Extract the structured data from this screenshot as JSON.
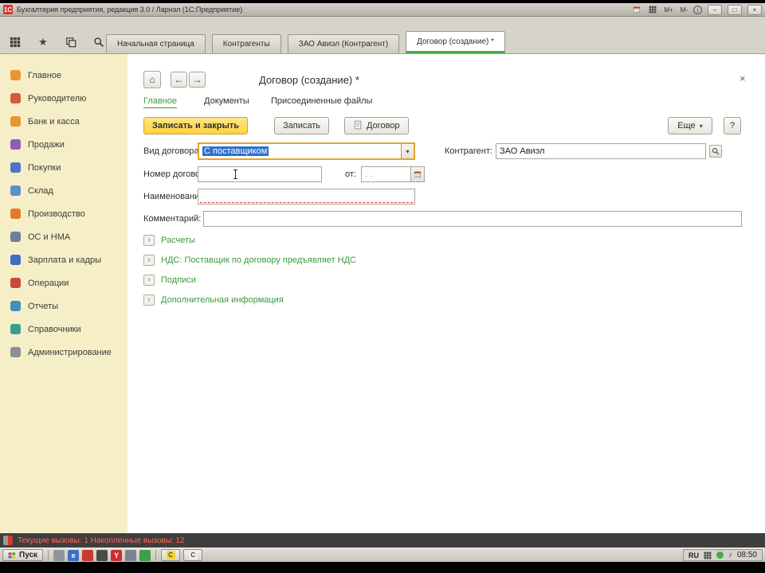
{
  "colors": {
    "accent_green": "#3c9a3c",
    "sidebar_bg": "#f6eec6",
    "save_button_yellow": "#ffd23a",
    "focus_border": "#e0a430",
    "selection_blue": "#2f6fd0",
    "required_red": "#e0392e",
    "status_text_red": "#ff6a5e"
  },
  "icons": {
    "star": "★",
    "history": "↺",
    "home": "⌂",
    "back": "←",
    "forward": "→",
    "dropdown": "▾",
    "section_arrow": "›",
    "note": "♪",
    "info": "i"
  },
  "titlebar": {
    "logo": "1С",
    "title": "Бухгалтерия предприятия, редакция 3.0 / Ларнэл (1С:Предприятие)",
    "mem_plus": "M+",
    "mem_minus": "M-",
    "minimize": "–",
    "maximize": "□",
    "close": "×"
  },
  "tabstrip": {
    "tabs": [
      {
        "label": "Начальная страница"
      },
      {
        "label": "Контрагенты"
      },
      {
        "label": "ЗАО Авиэл (Контрагент)"
      },
      {
        "label": "Договор (создание) *"
      }
    ]
  },
  "sidebar": {
    "items": [
      {
        "label": "Главное",
        "color": "#e8972e"
      },
      {
        "label": "Руководителю",
        "color": "#d8583a"
      },
      {
        "label": "Банк и касса",
        "color": "#e8972e"
      },
      {
        "label": "Продажи",
        "color": "#8e5bb8"
      },
      {
        "label": "Покупки",
        "color": "#4a77c4"
      },
      {
        "label": "Склад",
        "color": "#5b8fd4"
      },
      {
        "label": "Производство",
        "color": "#e07b28"
      },
      {
        "label": "ОС и НМА",
        "color": "#6b7f9e"
      },
      {
        "label": "Зарплата и кадры",
        "color": "#3f6fbf"
      },
      {
        "label": "Операции",
        "color": "#c44a3a"
      },
      {
        "label": "Отчеты",
        "color": "#3f8fbf"
      },
      {
        "label": "Справочники",
        "color": "#3a9e8e"
      },
      {
        "label": "Администрирование",
        "color": "#8a8f98"
      }
    ]
  },
  "form": {
    "title": "Договор (создание) *",
    "close": "×",
    "tabs": [
      {
        "label": "Главное"
      },
      {
        "label": "Документы"
      },
      {
        "label": "Присоединенные файлы"
      }
    ],
    "toolbar": {
      "save_close": "Записать и закрыть",
      "save": "Записать",
      "contract": "Договор",
      "more": "Еще",
      "help": "?"
    },
    "fields": {
      "kind": {
        "label": "Вид договора:",
        "value": "С поставщиком"
      },
      "counterparty": {
        "label": "Контрагент:",
        "value": "ЗАО Авиэл"
      },
      "number": {
        "label": "Номер договора:",
        "value": ""
      },
      "date": {
        "label": "от:",
        "placeholder": ". ."
      },
      "name": {
        "label": "Наименование:",
        "value": ""
      },
      "comment": {
        "label": "Комментарий:",
        "value": ""
      }
    },
    "sections": [
      {
        "label": "Расчеты"
      },
      {
        "label": "НДС: Поставщик по договору предъявляет НДС"
      },
      {
        "label": "Подписи"
      },
      {
        "label": "Дополнительная информация"
      }
    ]
  },
  "statusbar": {
    "text": "Текущие вызовы: 1  Накопленные вызовы: 12"
  },
  "taskbar": {
    "start": "Пуск",
    "quicklaunch": [
      {
        "letter": "",
        "bg": "#8f959e"
      },
      {
        "letter": "e",
        "bg": "#3a6fc4"
      },
      {
        "letter": "",
        "bg": "#c93a2e"
      },
      {
        "letter": "",
        "bg": "#4a4a4a"
      },
      {
        "letter": "Y",
        "bg": "#cc2d2d"
      },
      {
        "letter": "",
        "bg": "#7d838c"
      },
      {
        "letter": "",
        "bg": "#3f9e4a"
      }
    ],
    "windows": [
      {
        "letter": "С",
        "bg": "#f3d23a"
      },
      {
        "letter": "С",
        "bg": "#efefe9"
      }
    ],
    "tray": {
      "lang": "RU",
      "time": "08:50"
    }
  }
}
